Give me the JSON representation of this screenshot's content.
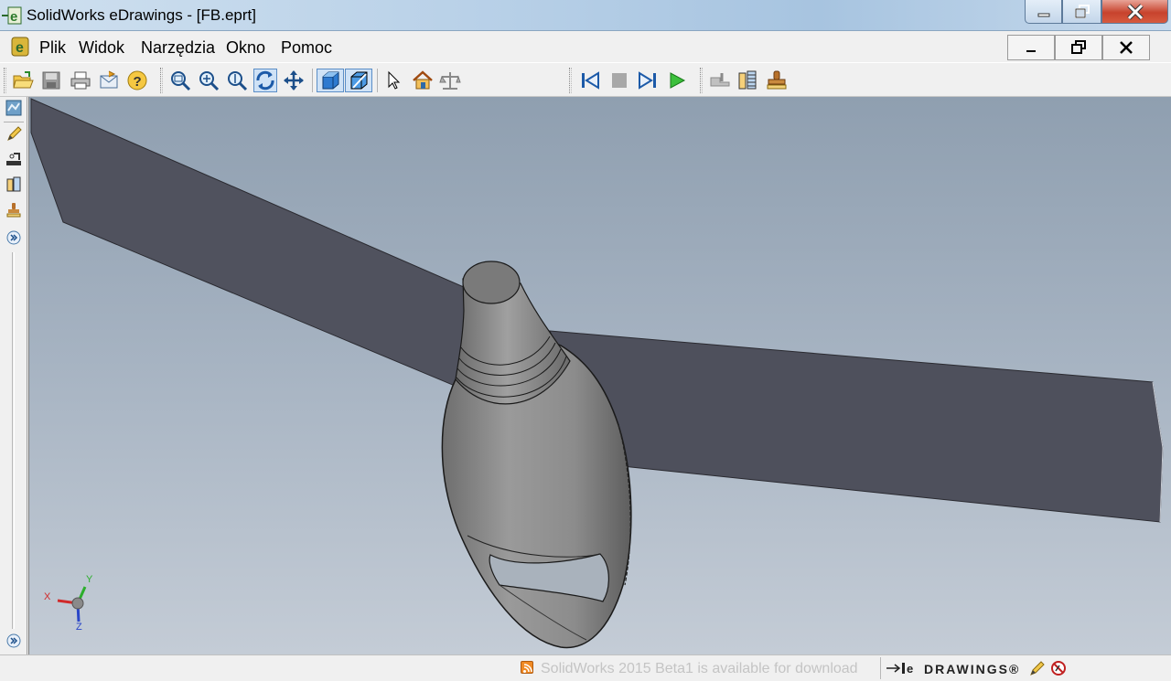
{
  "window": {
    "title": "SolidWorks eDrawings - [FB.eprt]"
  },
  "menu": {
    "items": [
      "Plik",
      "Widok",
      "Narzędzia",
      "Okno",
      "Pomoc"
    ]
  },
  "toolbar": {
    "icons": [
      "open-icon",
      "save-icon",
      "print-icon",
      "send-icon",
      "help-icon",
      "zoom-to-fit-icon",
      "zoom-to-area-icon",
      "zoom-in-out-icon",
      "rotate-icon",
      "pan-icon",
      "shaded-icon",
      "shaded-edges-icon",
      "select-icon",
      "home-icon",
      "measure-icon",
      "first-frame-icon",
      "stop-icon",
      "next-frame-icon",
      "play-icon",
      "section-icon",
      "explode-icon",
      "stamp-icon"
    ]
  },
  "left_toolbar": {
    "icons": [
      "sheet-icon",
      "markup-pen-icon",
      "measure-icon",
      "section-icon",
      "stamp-icon",
      "expand-icon"
    ]
  },
  "triad": {
    "x_label": "X",
    "y_label": "Y",
    "z_label": "Z"
  },
  "status": {
    "message": "SolidWorks 2015 Beta1 is available for download",
    "brand": "DRAWINGS®"
  },
  "colors": {
    "viewport_top": "#8f9fb0",
    "viewport_bottom": "#c4ccd6",
    "blade": "#50525e",
    "body": "#8a8a8a"
  }
}
